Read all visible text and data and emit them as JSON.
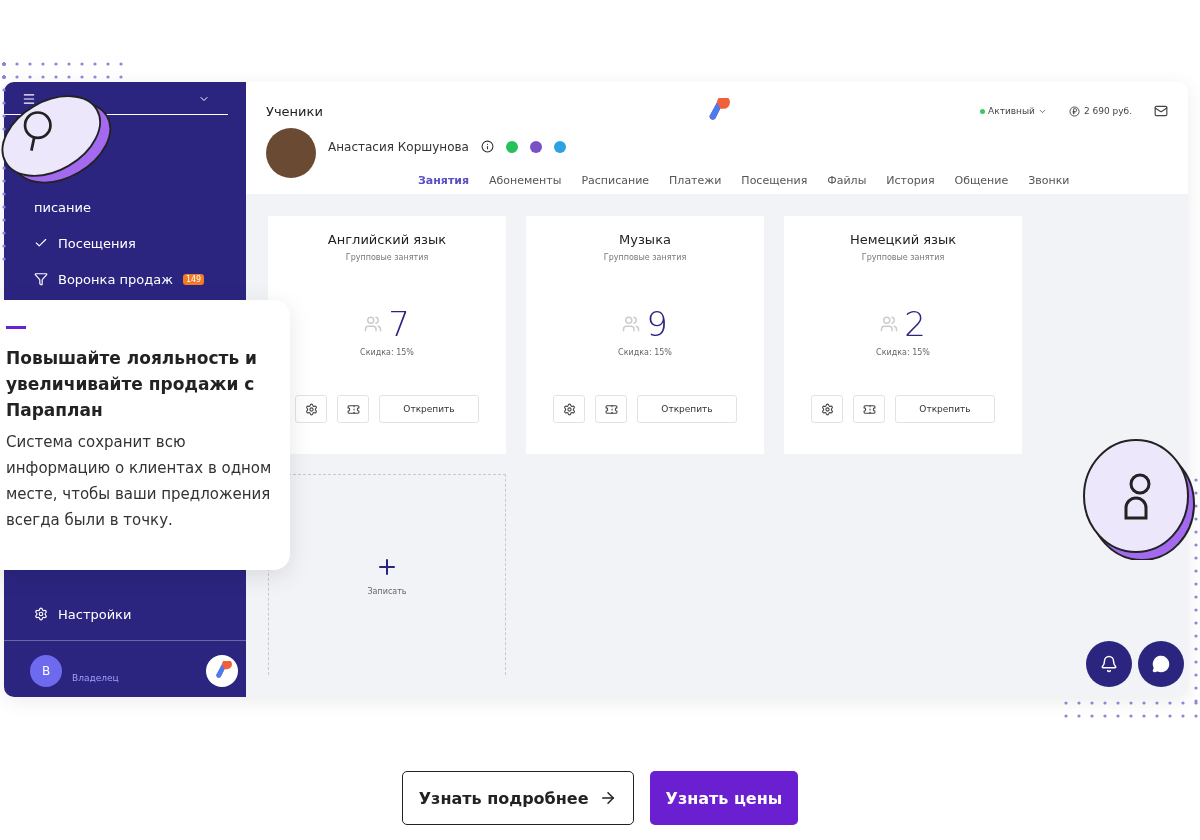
{
  "sidebar": {
    "items": [
      {
        "kind": "plain",
        "label": "писание"
      },
      {
        "kind": "check",
        "label": "Посещения"
      },
      {
        "kind": "funnel",
        "label": "Воронка продаж",
        "badge": "149"
      }
    ],
    "settings": "Настройки",
    "user": {
      "initial": "В",
      "role": "Владелец"
    }
  },
  "header": {
    "title": "Ученики",
    "status": "Активный",
    "balance": "2 690 руб.",
    "student": "Анастасия Коршунова",
    "tabs": [
      {
        "label": "Занятия",
        "selected": true
      },
      {
        "label": "Абонементы",
        "selected": false
      },
      {
        "label": "Расписание",
        "selected": false
      },
      {
        "label": "Платежи",
        "selected": false
      },
      {
        "label": "Посещения",
        "selected": false
      },
      {
        "label": "Файлы",
        "selected": false
      },
      {
        "label": "История",
        "selected": false
      },
      {
        "label": "Общение",
        "selected": false
      },
      {
        "label": "Звонки",
        "selected": false
      }
    ]
  },
  "courses": [
    {
      "title": "Английский язык",
      "type": "Групповые занятия",
      "count": "7",
      "discount": "Скидка: 15%",
      "button": "Открепить"
    },
    {
      "title": "Музыка",
      "type": "Групповые занятия",
      "count": "9",
      "discount": "Скидка: 15%",
      "button": "Открепить"
    },
    {
      "title": "Немецкий язык",
      "type": "Групповые занятия",
      "count": "2",
      "discount": "Скидка: 15%",
      "button": "Открепить"
    }
  ],
  "add_card": {
    "label": "Записать"
  },
  "promo": {
    "title": "Повышайте лояльность и увеличивайте продажи с Параплан",
    "text": "Система сохранит всю информацию о клиентах в одном месте, чтобы ваши предложения всегда были в точку."
  },
  "buttons": [
    {
      "label": "Узнать подробнее",
      "kind": "outline"
    },
    {
      "label": "Узнать цены",
      "kind": "primary"
    }
  ]
}
